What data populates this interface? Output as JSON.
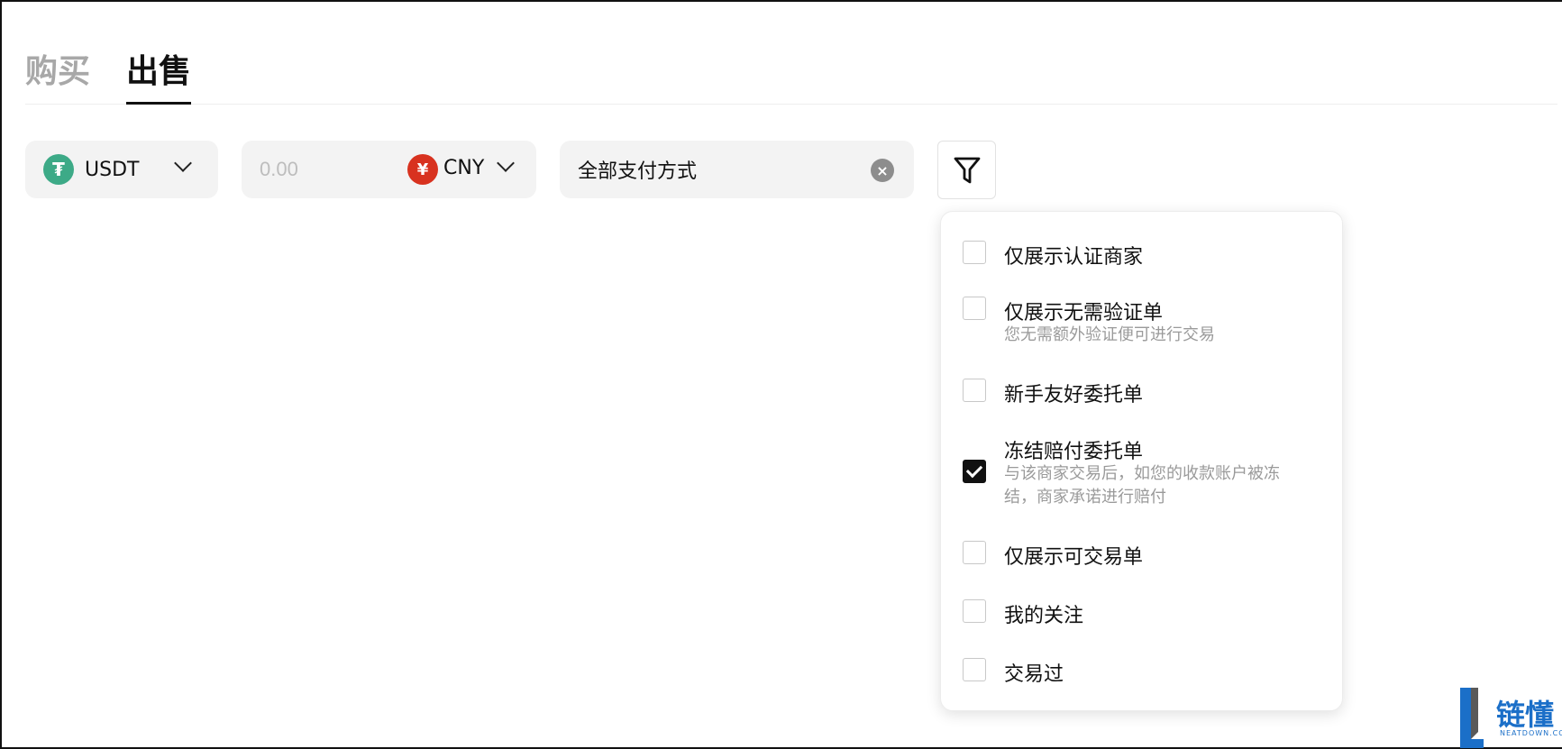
{
  "tabs": [
    {
      "label": "购买",
      "active": false
    },
    {
      "label": "出售",
      "active": true
    }
  ],
  "coin": {
    "label": "USDT",
    "icon": "tether-icon"
  },
  "amount": {
    "placeholder": "0.00",
    "currency": "CNY",
    "currency_icon": "yuan-icon"
  },
  "payment": {
    "label": "全部支付方式"
  },
  "filter_options": [
    {
      "title": "仅展示认证商家",
      "desc": "",
      "checked": false
    },
    {
      "title": "仅展示无需验证单",
      "desc": "您无需额外验证便可进行交易",
      "checked": false
    },
    {
      "title": "新手友好委托单",
      "desc": "",
      "checked": false
    },
    {
      "title": "冻结赔付委托单",
      "desc": "与该商家交易后，如您的收款账户被冻结，商家承诺进行赔付",
      "checked": true
    },
    {
      "title": "仅展示可交易单",
      "desc": "",
      "checked": false
    },
    {
      "title": "我的关注",
      "desc": "",
      "checked": false
    },
    {
      "title": "交易过",
      "desc": "",
      "checked": false
    }
  ],
  "watermark": {
    "text": "链懂",
    "sub": "NEATDOWN.COM"
  },
  "colors": {
    "tether": "#3daa87",
    "cny": "#d8321f",
    "watermark": "#1b6fc8"
  }
}
